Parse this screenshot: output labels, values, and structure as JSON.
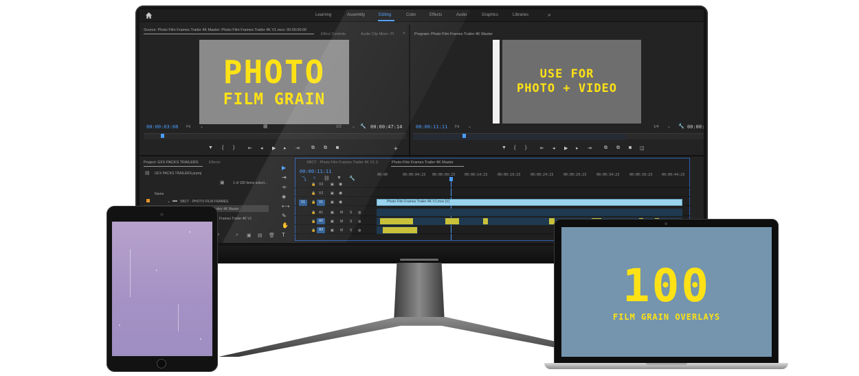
{
  "nav": {
    "items": [
      {
        "label": "Learning",
        "active": false
      },
      {
        "label": "Assembly",
        "active": false
      },
      {
        "label": "Editing",
        "active": true
      },
      {
        "label": "Color",
        "active": false
      },
      {
        "label": "Effects",
        "active": false
      },
      {
        "label": "Audio",
        "active": false
      },
      {
        "label": "Graphics",
        "active": false
      },
      {
        "label": "Libraries",
        "active": false
      }
    ],
    "more": "»"
  },
  "source_panel": {
    "tab": "Source: Photo Film Frames Trailer 4K Master: Photo Film Frames Trailer 4K V1.mov: 00:00:00:00",
    "effect_controls": "Effect Controls",
    "audio_mixer": "Audio Clip Mixer: Pl",
    "more": "»",
    "frame_line1": "PHOTO",
    "frame_line2": "FILM GRAIN",
    "timecode": "00:00:03:08",
    "fit": "Fit",
    "resolution": "1/2",
    "duration": "00:00:47:14"
  },
  "program_panel": {
    "tab": "Program: Photo Film Frames Trailer 4K Master",
    "frame_line1": "USE FOR",
    "frame_line2": "PHOTO + VIDEO",
    "timecode": "00:00:11:11",
    "fit": "Fit",
    "resolution": "1/4",
    "duration": "00:00:4"
  },
  "project_panel": {
    "tab": "Project: GFX PACKS TRAILERS",
    "effects_tab": "Effects",
    "file": "GFX PACKS TRAILERS.prproj",
    "count": "1 of 100 items select...",
    "name_header": "Name",
    "folder": "SBCT - PHOTO FILM FRAMES",
    "item1": "...es Trailer 4K Master",
    "item2": "Frames Trailer 4K V1"
  },
  "timeline": {
    "tab1": "SBCT - Photo Film Frames Trailer 4K V1.3",
    "tab2": "Photo Film Frames Trailer 4K Master",
    "timecode": "00:00:11:11",
    "ticks": [
      "00:00",
      "00:00:04:23",
      "00:00:09:23",
      "00:00:14:23",
      "00:00:19:23",
      "00:00:24:23",
      "00:00:29:23",
      "00:00:34:23",
      "00:00:39:23",
      "00:00:44:23"
    ],
    "tracks": [
      "V3",
      "V2",
      "V1",
      "A1",
      "A2",
      "A3"
    ],
    "v1_source": "V1",
    "a_sources": [
      "A1",
      "A2",
      "A3"
    ],
    "clip_label": "Photo Film Frames Trailer 4K V1.mov [V]"
  },
  "laptop": {
    "big": "100",
    "small": "FILM GRAIN OVERLAYS"
  },
  "colors": {
    "accent": "#4b9cff",
    "yellow_text": "#ffe215",
    "tablet_screen": "#a591c4",
    "laptop_screen": "#7495ad"
  }
}
